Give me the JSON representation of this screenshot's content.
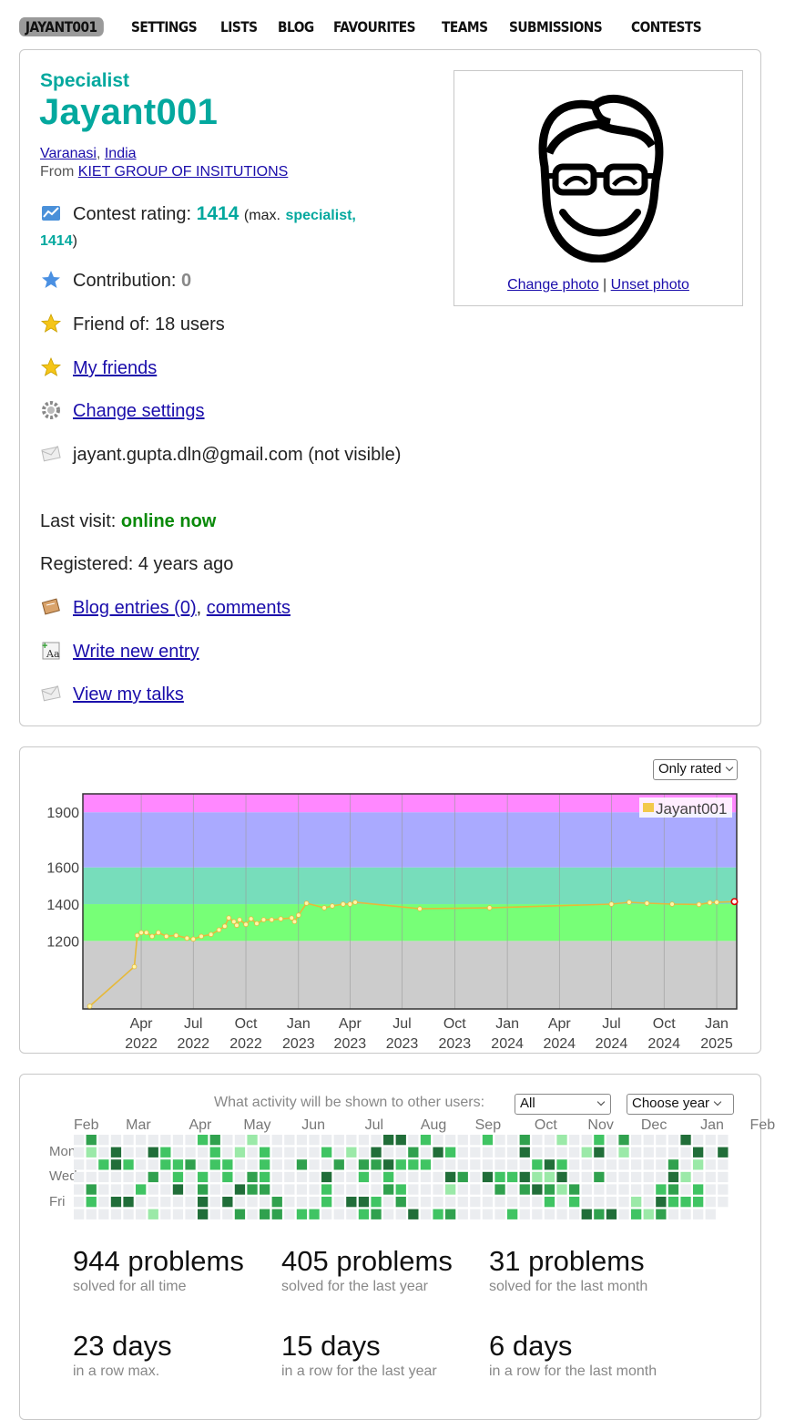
{
  "nav": [
    "JAYANT001",
    "SETTINGS",
    "LISTS",
    "BLOG",
    "FAVOURITES",
    "TEAMS",
    "SUBMISSIONS",
    "CONTESTS"
  ],
  "profile": {
    "rank": "Specialist",
    "handle": "Jayant001",
    "city": "Varanasi",
    "country": "India",
    "from_label": "From",
    "org": "KIET GROUP OF INSITUTIONS",
    "rating_label": "Contest rating:",
    "rating": "1414",
    "max_prefix": "(max.",
    "max_rank": "specialist,",
    "max_rating": "1414",
    "max_suffix": ")",
    "contribution_label": "Contribution:",
    "contribution": "0",
    "friend_of": "Friend of: 18 users",
    "my_friends": "My friends",
    "change_settings": "Change settings",
    "email": "jayant.gupta.dln@gmail.com (not visible)",
    "last_visit_label": "Last visit:",
    "last_visit": "online now",
    "registered": "Registered: 4 years ago",
    "blog_entries": "Blog entries (0)",
    "comments": "comments",
    "write_entry": "Write new entry",
    "view_talks": "View my talks",
    "change_photo": "Change photo",
    "unset_photo": "Unset photo",
    "photo_sep": "|"
  },
  "rating_chart": {
    "filter": "Only rated",
    "legend": "Jayant001",
    "chart_data": {
      "type": "line",
      "series": [
        {
          "name": "Jayant001",
          "color": "#f2c94c",
          "points": [
            [
              "2022-01-01",
              845
            ],
            [
              "2022-03-20",
              1060
            ],
            [
              "2022-03-25",
              1230
            ],
            [
              "2022-04-01",
              1245
            ],
            [
              "2022-04-10",
              1245
            ],
            [
              "2022-04-20",
              1225
            ],
            [
              "2022-05-01",
              1245
            ],
            [
              "2022-05-15",
              1225
            ],
            [
              "2022-06-01",
              1230
            ],
            [
              "2022-06-20",
              1215
            ],
            [
              "2022-07-01",
              1210
            ],
            [
              "2022-07-15",
              1225
            ],
            [
              "2022-08-01",
              1235
            ],
            [
              "2022-08-15",
              1260
            ],
            [
              "2022-08-25",
              1280
            ],
            [
              "2022-09-01",
              1325
            ],
            [
              "2022-09-10",
              1305
            ],
            [
              "2022-09-15",
              1285
            ],
            [
              "2022-09-20",
              1315
            ],
            [
              "2022-10-01",
              1290
            ],
            [
              "2022-10-10",
              1320
            ],
            [
              "2022-10-20",
              1295
            ],
            [
              "2022-11-01",
              1315
            ],
            [
              "2022-11-15",
              1315
            ],
            [
              "2022-12-01",
              1320
            ],
            [
              "2022-12-20",
              1325
            ],
            [
              "2022-12-25",
              1305
            ],
            [
              "2023-01-01",
              1340
            ],
            [
              "2023-01-15",
              1405
            ],
            [
              "2023-02-15",
              1380
            ],
            [
              "2023-03-01",
              1390
            ],
            [
              "2023-03-20",
              1400
            ],
            [
              "2023-04-01",
              1400
            ],
            [
              "2023-04-10",
              1410
            ],
            [
              "2023-08-01",
              1375
            ],
            [
              "2023-12-01",
              1380
            ],
            [
              "2024-07-01",
              1400
            ],
            [
              "2024-08-01",
              1410
            ],
            [
              "2024-09-01",
              1405
            ],
            [
              "2024-10-15",
              1400
            ],
            [
              "2024-12-01",
              1398
            ],
            [
              "2024-12-20",
              1408
            ],
            [
              "2025-01-01",
              1410
            ],
            [
              "2025-02-01",
              1414
            ]
          ]
        }
      ],
      "x_ticks": [
        "Apr 2022",
        "Jul 2022",
        "Oct 2022",
        "Jan 2023",
        "Apr 2023",
        "Jul 2023",
        "Oct 2023",
        "Jan 2024",
        "Apr 2024",
        "Jul 2024",
        "Oct 2024",
        "Jan 2025"
      ],
      "y_ticks": [
        1200,
        1400,
        1600,
        1900
      ],
      "ylim": [
        830,
        2000
      ],
      "bands": [
        {
          "from": 0,
          "to": 1200,
          "color": "#cccccc"
        },
        {
          "from": 1200,
          "to": 1400,
          "color": "#77ff77"
        },
        {
          "from": 1400,
          "to": 1600,
          "color": "#77ddbb"
        },
        {
          "from": 1600,
          "to": 1900,
          "color": "#aaaaff"
        },
        {
          "from": 1900,
          "to": 2000,
          "color": "#ff88ff"
        }
      ]
    }
  },
  "activity": {
    "label": "What activity will be shown to other users:",
    "filter": "All",
    "year": "Choose year",
    "months": [
      "Feb",
      "Mar",
      "Apr",
      "May",
      "Jun",
      "Jul",
      "Aug",
      "Sep",
      "Oct",
      "Nov",
      "Dec",
      "Jan",
      "Feb"
    ],
    "days": [
      "Mon",
      "Wed",
      "Fri"
    ],
    "colors": [
      "#ebedf0",
      "#9be9a8",
      "#40c463",
      "#30a14e",
      "#216e39"
    ],
    "weeks": 53
  },
  "stats": [
    {
      "value": "944 problems",
      "label": "solved for all time"
    },
    {
      "value": "405 problems",
      "label": "solved for the last year"
    },
    {
      "value": "31 problems",
      "label": "solved for the last month"
    },
    {
      "value": "23 days",
      "label": "in a row max."
    },
    {
      "value": "15 days",
      "label": "in a row for the last year"
    },
    {
      "value": "6 days",
      "label": "in a row for the last month"
    }
  ]
}
